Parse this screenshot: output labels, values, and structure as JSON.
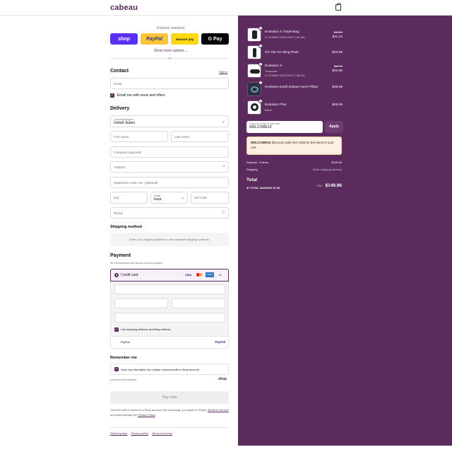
{
  "brand": "cabeau",
  "express": {
    "title": "Express checkout",
    "shop": "shop",
    "paypal": "PayPal",
    "amazon": "amazon pay",
    "gpay": "G Pay",
    "more": "Show more options",
    "or": "OR"
  },
  "contact": {
    "title": "Contact",
    "signin": "Sign in",
    "email_placeholder": "Email",
    "news": "Email me with news and offers"
  },
  "delivery": {
    "title": "Delivery",
    "country_label": "Country/Region",
    "country": "United States",
    "first": "First name",
    "last": "Last name",
    "company": "Company (optional)",
    "address": "Address",
    "apt": "Apartment, suite, etc. (optional)",
    "city": "City",
    "state_label": "State",
    "state": "Iowa",
    "zip": "ZIP code",
    "phone": "Phone"
  },
  "shipping": {
    "title": "Shipping method",
    "note": "Enter your shipping address to view available shipping methods."
  },
  "payment": {
    "title": "Payment",
    "secure": "All transactions are secure and encrypted.",
    "credit": "Credit card",
    "visa": "VISA",
    "amex": "AMEX",
    "more_cards": "+4",
    "billing": "Use shipping address as billing address",
    "paypal": "PayPal",
    "paypal_logo": "PayPal"
  },
  "remember": {
    "title": "Remember me",
    "save": "Save my information for a faster checkout with a Shop account",
    "secure": "Secure and encrypted",
    "shop": "shop"
  },
  "paynow": "Pay now",
  "legal": {
    "line1": "Your info will be saved to a Shop account. By continuing, you agree to Shop's",
    "terms": "Terms of Service",
    "and": "and acknowledge the",
    "privacy": "Privacy Policy",
    "end": "."
  },
  "footer": {
    "refund": "Refund policy",
    "privacy": "Privacy policy",
    "terms": "Terms of service"
  },
  "cart": {
    "items": [
      {
        "qty": "1",
        "name": "Evolution X Travel Bag",
        "discount": "COMBO DISCOUNT (-$1.69)",
        "old": "$12.99",
        "price": "$11.24"
      },
      {
        "qty": "1",
        "name": "On The Go Sling Pack",
        "price": "$24.99"
      },
      {
        "qty": "1",
        "name": "Evolution X",
        "variant": "Turquoise",
        "discount": "COMBO DISCOUNT (-$6.34)",
        "old": "$49.99",
        "price": "$43.65"
      },
      {
        "qty": "1",
        "name": "Evolution Earth Deluxe Neck Pillow",
        "price": "$39.99"
      },
      {
        "qty": "1",
        "name": "Evolution Plus",
        "variant": "Black",
        "price": "$29.99"
      }
    ],
    "code_label": "Discount code or gift card",
    "code": "WELCOME10",
    "apply": "Apply",
    "warning_code": "WELCOME10",
    "warning": "discount code isn't valid for the items in your cart",
    "subtotal_label": "Subtotal · 5 items",
    "subtotal": "$149.96",
    "shipping_label": "Shipping",
    "shipping": "Enter shipping address",
    "total_label": "Total",
    "currency": "USD",
    "total": "$149.96",
    "savings_label": "TOTAL SAVINGS",
    "savings": "$7.99"
  },
  "colors": {
    "brand": "#5b2b5e",
    "shop": "#5a31f4",
    "paypal": "#ffc439",
    "amazon": "#ffd814"
  }
}
